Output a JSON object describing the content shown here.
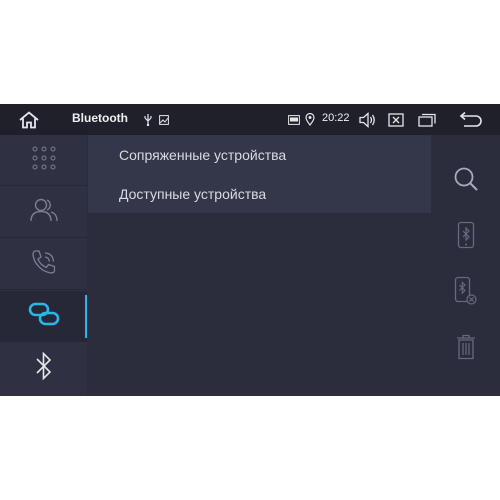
{
  "status_bar": {
    "title": "Bluetooth",
    "time": "20:22",
    "icons": [
      "home-icon",
      "usb-icon",
      "picture-icon",
      "cast-icon",
      "location-icon",
      "volume-icon",
      "close-window-icon",
      "recent-apps-icon",
      "back-icon"
    ]
  },
  "sidebar": {
    "items": [
      {
        "name": "dialpad-icon",
        "active": false
      },
      {
        "name": "contacts-icon",
        "active": false
      },
      {
        "name": "call-log-icon",
        "active": false
      },
      {
        "name": "link-icon",
        "active": true
      },
      {
        "name": "bluetooth-icon",
        "active": false
      }
    ]
  },
  "menu": {
    "items": [
      {
        "label": "Сопряженные устройства"
      },
      {
        "label": "Доступные устройства"
      }
    ]
  },
  "right_actions": {
    "icons": [
      "search-icon",
      "phone-bluetooth-icon",
      "phone-remove-icon",
      "trash-icon"
    ]
  },
  "colors": {
    "accent": "#2bb7e6",
    "background": "#2b2d3c",
    "statusbar": "#1f2029"
  }
}
